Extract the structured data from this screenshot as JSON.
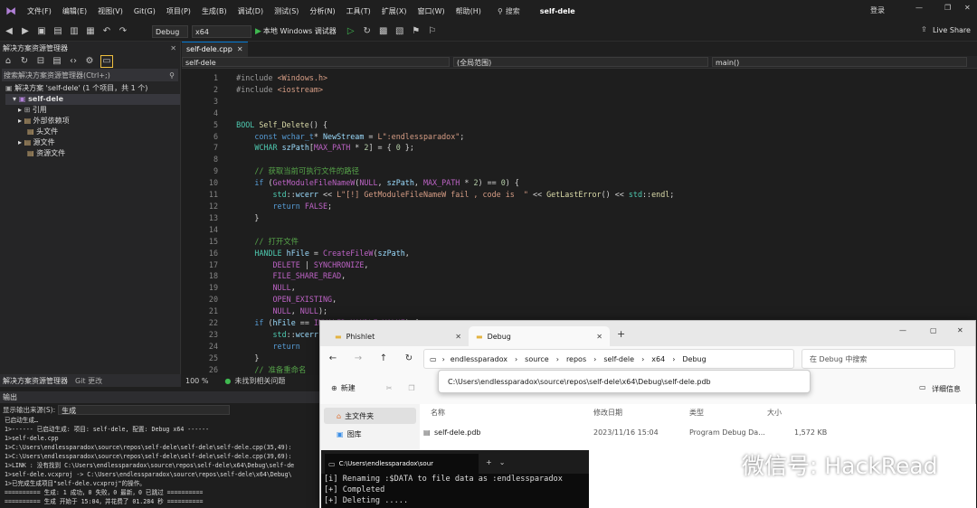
{
  "menu": {
    "items": [
      "文件(F)",
      "编辑(E)",
      "视图(V)",
      "Git(G)",
      "项目(P)",
      "生成(B)",
      "调试(D)",
      "测试(S)",
      "分析(N)",
      "工具(T)",
      "扩展(X)",
      "窗口(W)",
      "帮助(H)"
    ],
    "search": "搜索",
    "solution_name": "self-dele",
    "login": "登录",
    "live_share": "Live Share"
  },
  "toolbar": {
    "config": "Debug",
    "platform": "x64",
    "run_label": "本地 Windows 调试器"
  },
  "solution_explorer": {
    "title": "解决方案资源管理器",
    "search_placeholder": "搜索解决方案资源管理器(Ctrl+;)",
    "solution": "解决方案 'self-dele' (1 个项目，共 1 个)",
    "project": "self-dele",
    "nodes": [
      "引用",
      "外部依赖项",
      "头文件",
      "源文件",
      "资源文件"
    ],
    "tab1": "解决方案资源管理器",
    "tab2": "Git 更改"
  },
  "editor": {
    "tab": "self-dele.cpp",
    "nav_project": "self-dele",
    "nav_scope": "(全局范围)",
    "nav_func": "main()",
    "zoom": "100 %",
    "status": "未找到相关问题"
  },
  "output": {
    "title": "输出",
    "source_label": "显示输出来源(S):",
    "source_value": "生成",
    "lines": [
      "已启动生成…",
      "1>------ 已启动生成: 项目: self-dele, 配置: Debug x64 ------",
      "1>self-dele.cpp",
      "1>C:\\Users\\endlessparadox\\source\\repos\\self-dele\\self-dele\\self-dele.cpp(35,49):",
      "1>C:\\Users\\endlessparadox\\source\\repos\\self-dele\\self-dele\\self-dele.cpp(39,69):",
      "1>LINK : 没有找到 C:\\Users\\endlessparadox\\source\\repos\\self-dele\\x64\\Debug\\self-de",
      "1>self-dele.vcxproj -> C:\\Users\\endlessparadox\\source\\repos\\self-dele\\x64\\Debug\\",
      "1>已完成生成项目\"self-dele.vcxproj\"的操作。",
      "========== 生成: 1 成功，0 失败，0 最新，0 已跳过 ==========",
      "========== 生成 开始于 15:04，并花费了 01.284 秒 =========="
    ]
  },
  "explorer": {
    "tab1": "Phishlet",
    "tab2": "Debug",
    "crumbs": [
      "endlessparadox",
      "source",
      "repos",
      "self-dele",
      "x64",
      "Debug"
    ],
    "search_placeholder": "在 Debug 中搜索",
    "path_popup": "C:\\Users\\endlessparadox\\source\\repos\\self-dele\\x64\\Debug\\self-dele.pdb",
    "new_label": "新建",
    "details_label": "详细信息",
    "side_items": [
      "主文件夹",
      "图库"
    ],
    "columns": [
      "名称",
      "修改日期",
      "类型",
      "大小"
    ],
    "files": [
      {
        "name": "self-dele.pdb",
        "date": "2023/11/16 15:04",
        "type": "Program Debug Da...",
        "size": "1,572 KB"
      }
    ]
  },
  "terminal": {
    "tab": "C:\\Users\\endlessparadox\\sour",
    "lines": [
      "[i] Renaming :$DATA to file data as :endlessparadox",
      "[+] Completed",
      "[+] Deleting ....."
    ]
  },
  "watermark": "微信号: HackRead"
}
